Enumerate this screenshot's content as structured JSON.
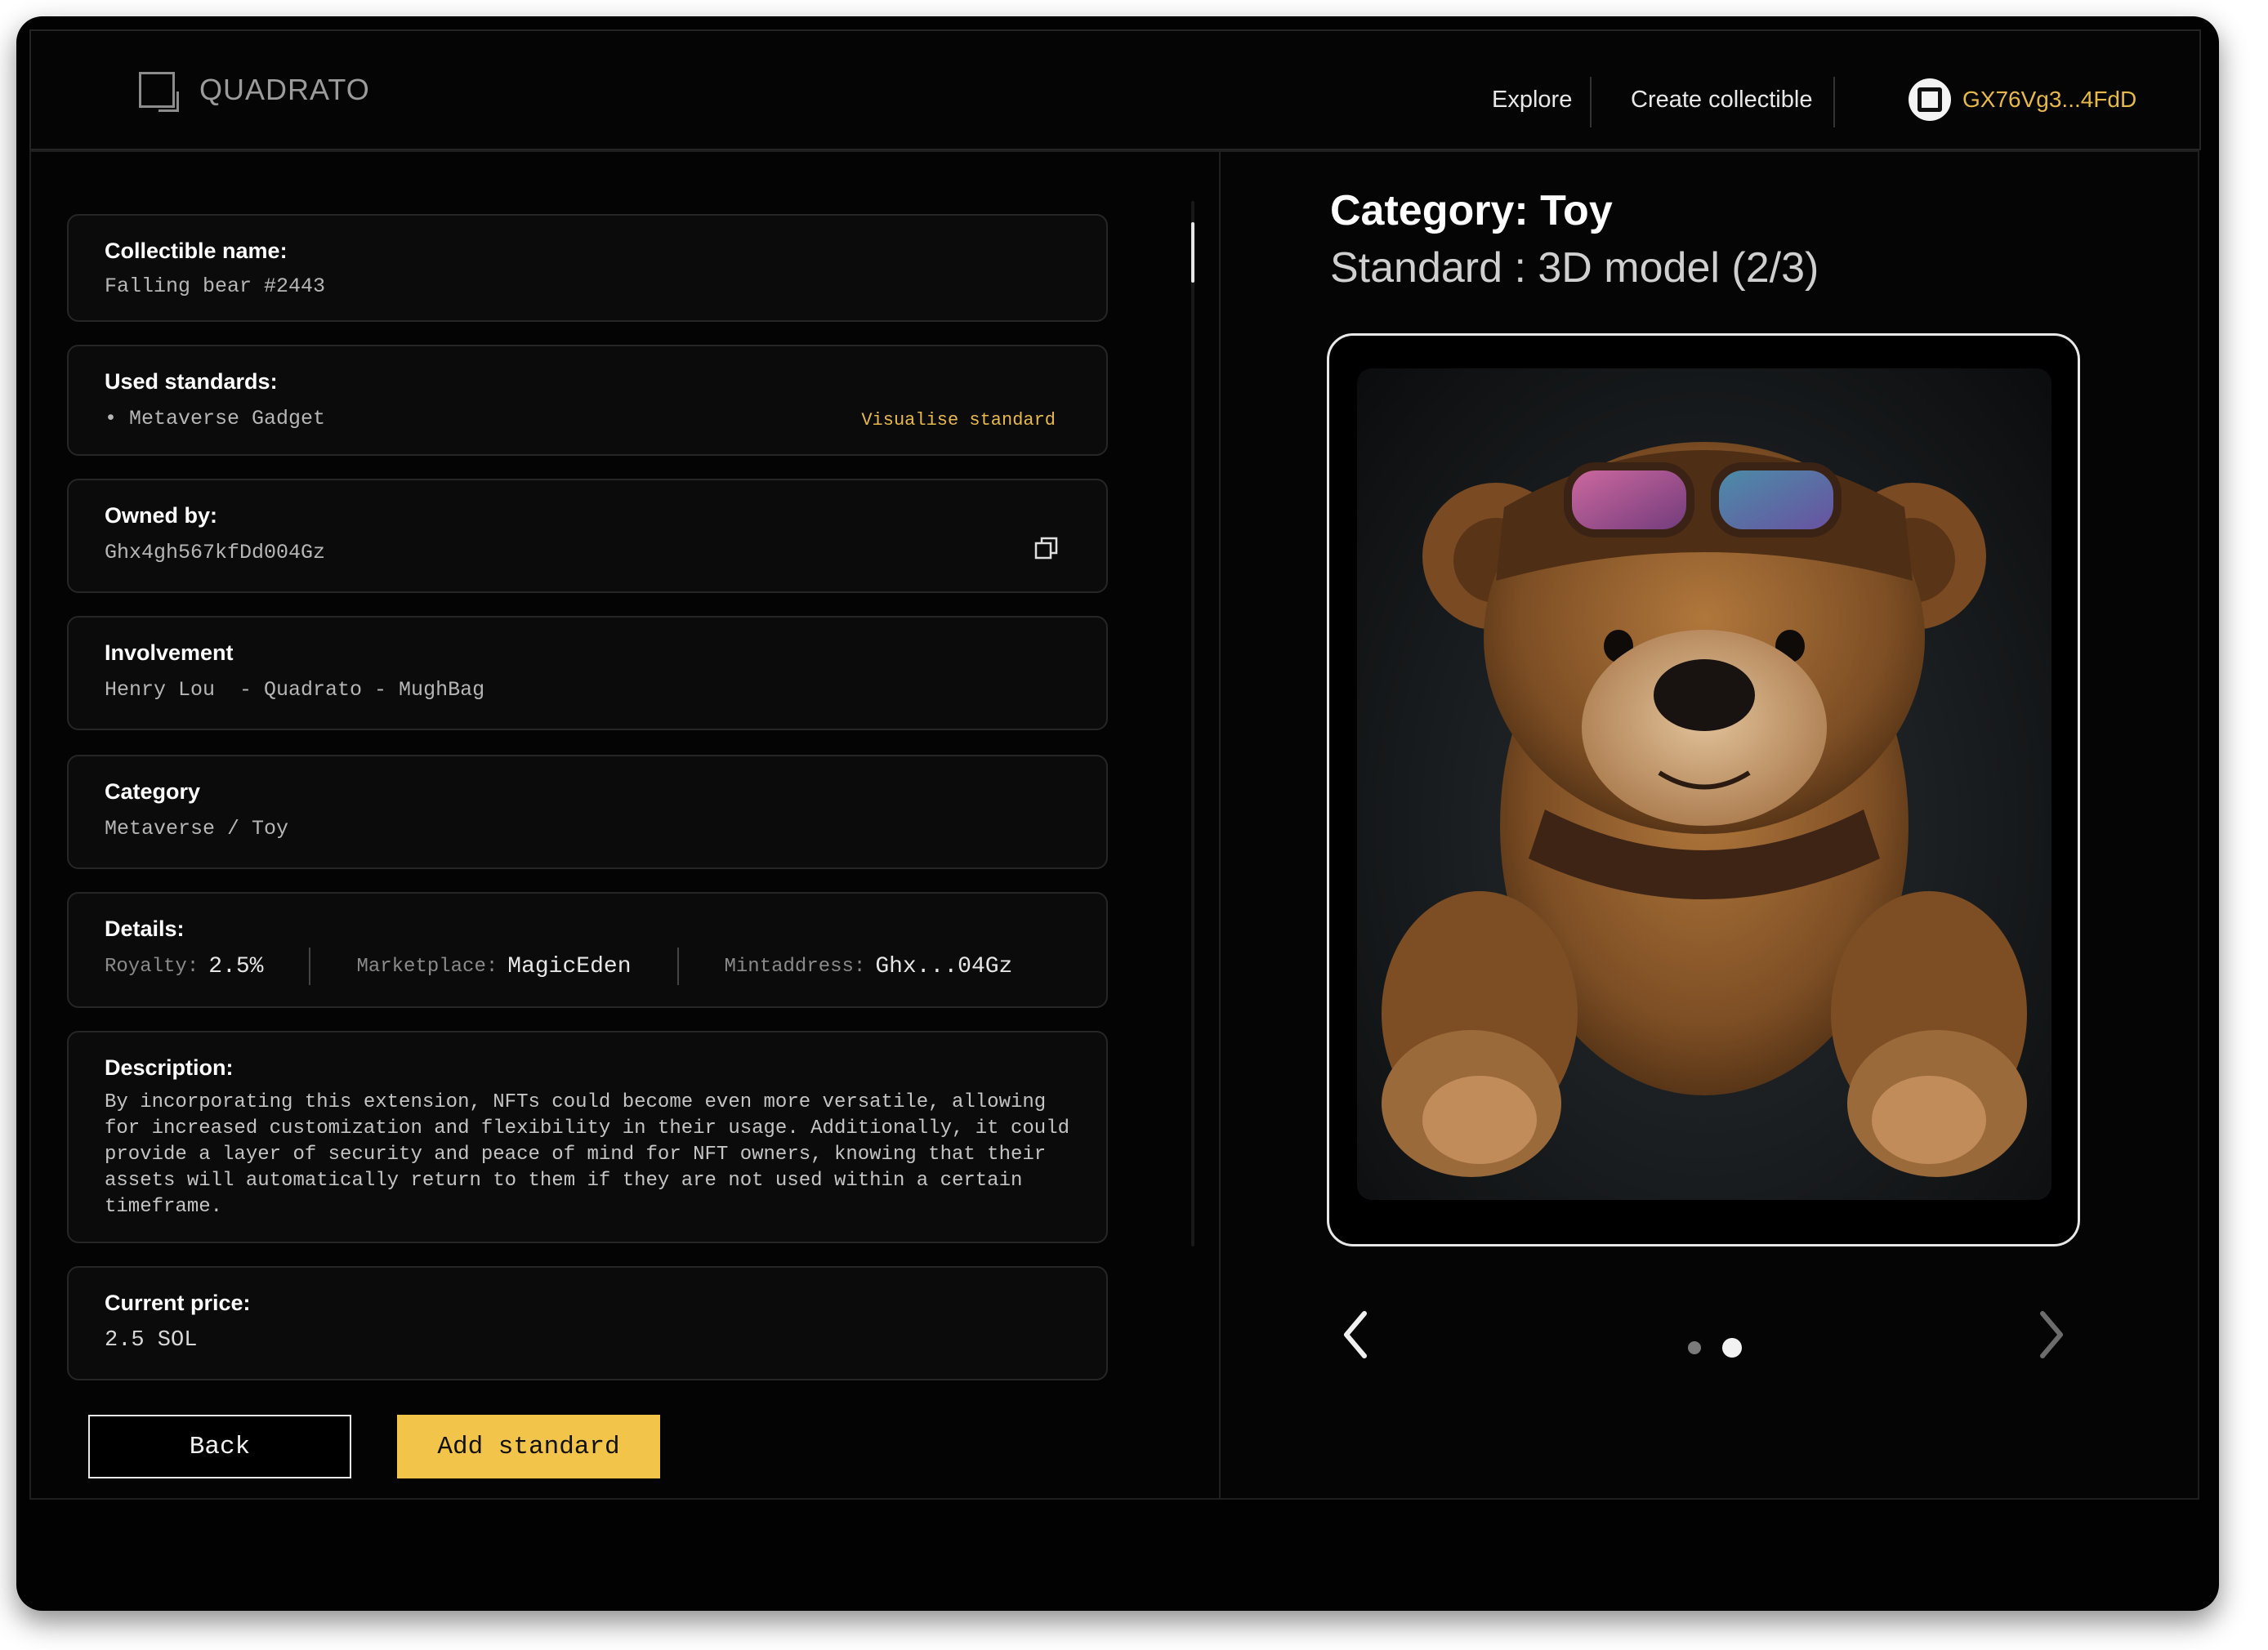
{
  "app": {
    "logo_text": "QUADRATO"
  },
  "nav": {
    "explore": "Explore",
    "create": "Create collectible",
    "wallet": "GX76Vg3...4FdD"
  },
  "fields": {
    "name": {
      "label": "Collectible name:",
      "value": "Falling bear #2443"
    },
    "standards": {
      "label": "Used standards:",
      "value": "• Metaverse Gadget",
      "link": "Visualise standard"
    },
    "owner": {
      "label": "Owned by:",
      "value": "Ghx4gh567kfDd004Gz"
    },
    "involvement": {
      "label": "Involvement",
      "value": "Henry Lou  - Quadrato - MughBag"
    },
    "category": {
      "label": "Category",
      "value": "Metaverse / Toy"
    },
    "details": {
      "label": "Details:",
      "royalty_label": "Royalty:",
      "royalty": "2.5%",
      "marketplace_label": "Marketplace:",
      "marketplace": "MagicEden",
      "mint_label": "Mintaddress:",
      "mint": "Ghx...04Gz"
    },
    "description": {
      "label": "Description:",
      "text": "By incorporating this extension, NFTs could become even more versatile, allowing for increased customization and flexibility in their usage. Additionally, it could provide a layer of security and peace of mind for NFT owners, knowing that their assets will automatically return to them if they are not used within a certain timeframe."
    },
    "price": {
      "label": "Current price:",
      "value": "2.5 SOL"
    }
  },
  "buttons": {
    "back": "Back",
    "add": "Add standard"
  },
  "preview": {
    "title": "Category: Toy",
    "subtitle": "Standard : 3D model (2/3)",
    "carousel_active_index": 2,
    "carousel_dots": 2
  },
  "icons": {
    "logo": "quadrato-logo-icon",
    "wallet": "wallet-icon",
    "copy": "copy-icon",
    "prev": "chevron-left-icon",
    "next": "chevron-right-icon"
  },
  "colors": {
    "accent": "#f2c44a",
    "wallet_text": "#e6b94a",
    "background": "#020202"
  }
}
